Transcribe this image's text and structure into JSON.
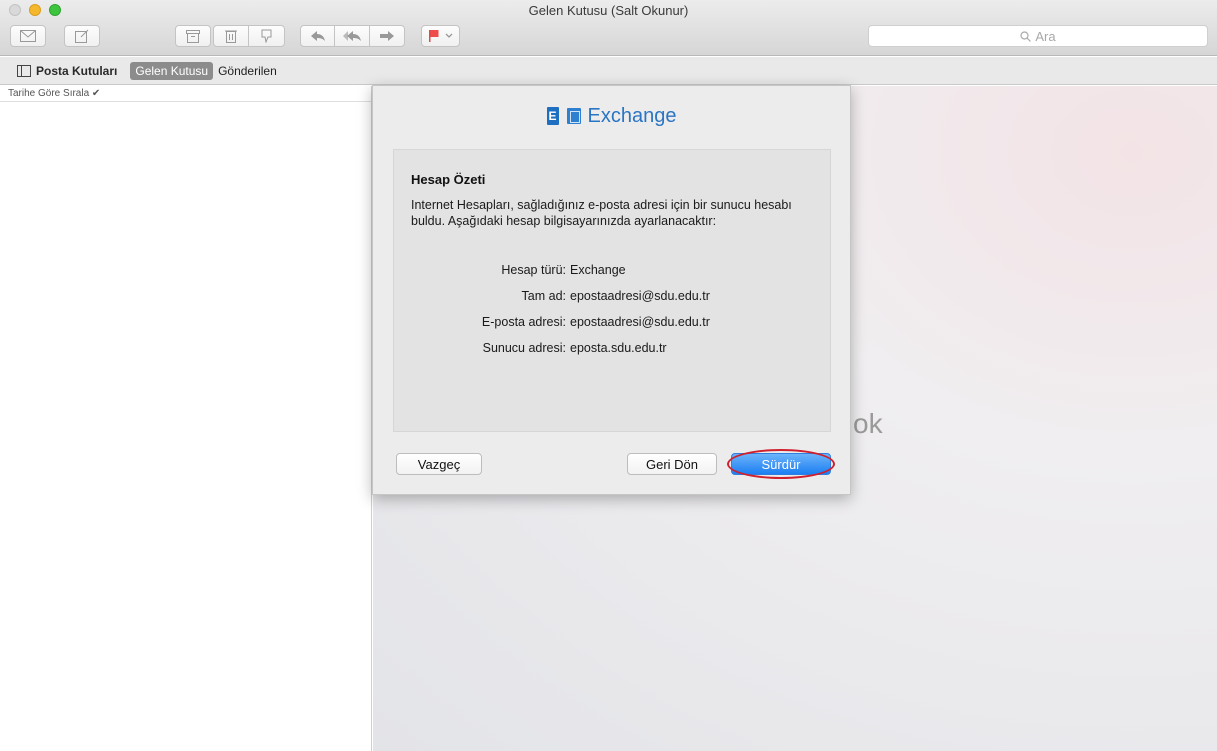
{
  "window": {
    "title": "Gelen Kutusu (Salt Okunur)"
  },
  "toolbar": {
    "search_placeholder": "Ara",
    "buttons": [
      "get-mail",
      "compose",
      "archive",
      "delete",
      "junk",
      "reply",
      "reply-all",
      "forward",
      "flag"
    ]
  },
  "favorites": {
    "mailboxes_label": "Posta Kutuları",
    "inbox_label": "Gelen Kutusu",
    "sent_label": "Gönderilen"
  },
  "message_list": {
    "sort_label": "Tarihe Göre Sırala ✔"
  },
  "preview": {
    "empty_text": "ok"
  },
  "dialog": {
    "brand": "Exchange",
    "title": "Hesap Özeti",
    "description": "Internet Hesapları, sağladığınız e-posta adresi için bir sunucu hesabı buldu. Aşağıdaki hesap bilgisayarınızda ayarlanacaktır:",
    "fields": [
      {
        "label": "Hesap türü:",
        "value": "Exchange"
      },
      {
        "label": "Tam ad:",
        "value": "epostaadresi@sdu.edu.tr"
      },
      {
        "label": "E-posta adresi:",
        "value": "epostaadresi@sdu.edu.tr"
      },
      {
        "label": "Sunucu adresi:",
        "value": "eposta.sdu.edu.tr"
      }
    ],
    "cancel_label": "Vazgeç",
    "back_label": "Geri Dön",
    "continue_label": "Sürdür"
  },
  "colors": {
    "accent_blue": "#1c7ff2",
    "highlight_red": "#d0202e",
    "exchange_blue": "#2a75c4"
  }
}
